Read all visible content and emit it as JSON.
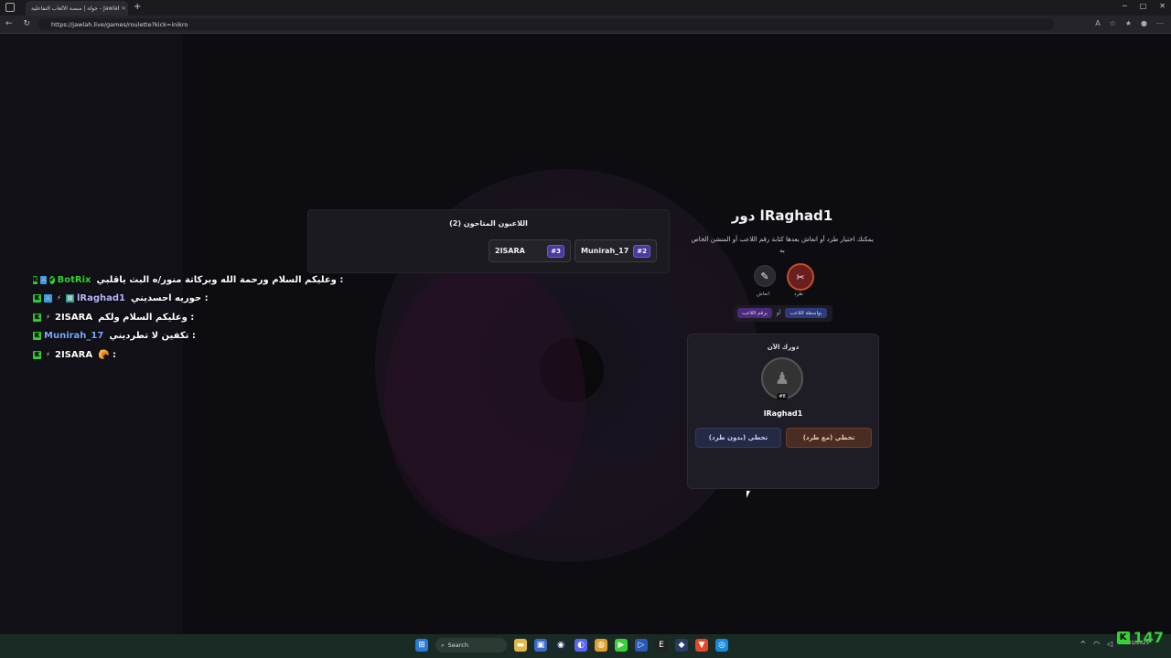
{
  "browser": {
    "tab_title": "جولة | منصة الألعاب التفاعلية - Jawlah",
    "url": "https://jawlah.live/games/roulette?kick=inikro"
  },
  "players_panel": {
    "title": "اللاعبون المتاحون (2)",
    "players": [
      {
        "name": "2ISARA",
        "num": "#3"
      },
      {
        "name": "Munirah_17",
        "num": "#2"
      }
    ]
  },
  "turn": {
    "title": "دور lRaghad1",
    "desc": "يمكنك اختيار طرد أو انعاش بعدها كتابة رقم اللاعب أو المنشن الخاص به",
    "kick_label": "طرد",
    "revive_label": "انعاش",
    "by_name": "بواسطة اللاعب",
    "or": "أو",
    "by_number": "برقم اللاعب",
    "current_label": "دورك الآن",
    "current_player": "lRaghad1",
    "avatar_badge": "#8",
    "skip_with_kick": "تخطي (مع طرد)",
    "skip_without_kick": "تخطي (بدون طرد)"
  },
  "chat": [
    {
      "user": "BotRix",
      "text": "وعليكم السلام ورحمة الله وبركاتة منور/ه البث ياقلبي :",
      "color": "#35d335",
      "badges": [
        "K",
        "⚔",
        "✔"
      ]
    },
    {
      "user": "lRaghad1",
      "text": "حوريه احسديني :",
      "color": "#b8b8ff",
      "badges": [
        "K",
        "⚔",
        "⚡",
        "▦"
      ]
    },
    {
      "user": "2ISARA",
      "text": "وعليكم السلام ولكم :",
      "color": "#ffffff",
      "badges": [
        "K",
        "⚡"
      ]
    },
    {
      "user": "Munirah_17",
      "text": "تكفين لا تطرديني :",
      "color": "#7aa8ff",
      "badges": [
        "K"
      ]
    },
    {
      "user": "2ISARA",
      "text": "🥐 :",
      "color": "#ffffff",
      "badges": [
        "K",
        "⚡"
      ]
    }
  ],
  "taskbar": {
    "search": "Search",
    "date": "10/31/2025",
    "kick_viewers": "147"
  }
}
